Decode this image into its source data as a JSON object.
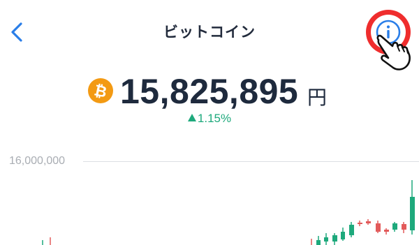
{
  "header": {
    "title": "ビットコイン",
    "back_icon": "chevron-left-icon",
    "info_icon": "info-icon",
    "accent_color": "#2a7ee8",
    "highlight_color": "#ef2d2d"
  },
  "price": {
    "coin_icon": "bitcoin-icon",
    "coin_color": "#f39a13",
    "value": "15,825,895",
    "unit": "円",
    "change": "1.15%",
    "change_direction": "up",
    "change_color": "#1ea97c"
  },
  "chart": {
    "grid_label": "16,000,000",
    "up_color": "#1ea97c",
    "down_color": "#e25a5a"
  }
}
